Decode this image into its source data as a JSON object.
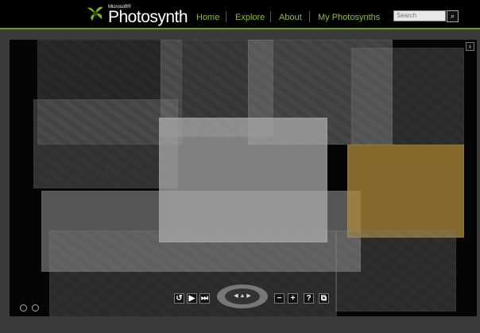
{
  "header": {
    "brand_small": "Microsoft®",
    "brand": "Photosynth",
    "nav": [
      "Home",
      "Explore",
      "About",
      "My Photosynths"
    ],
    "search_placeholder": "Search"
  },
  "controls": {
    "rotate": "↺",
    "play": "▶",
    "step": "⏭",
    "zoom_out": "−",
    "zoom_in": "+",
    "help": "?",
    "overlay": "⧉",
    "expand": "›"
  },
  "colors": {
    "accent": "#8cc21c"
  }
}
